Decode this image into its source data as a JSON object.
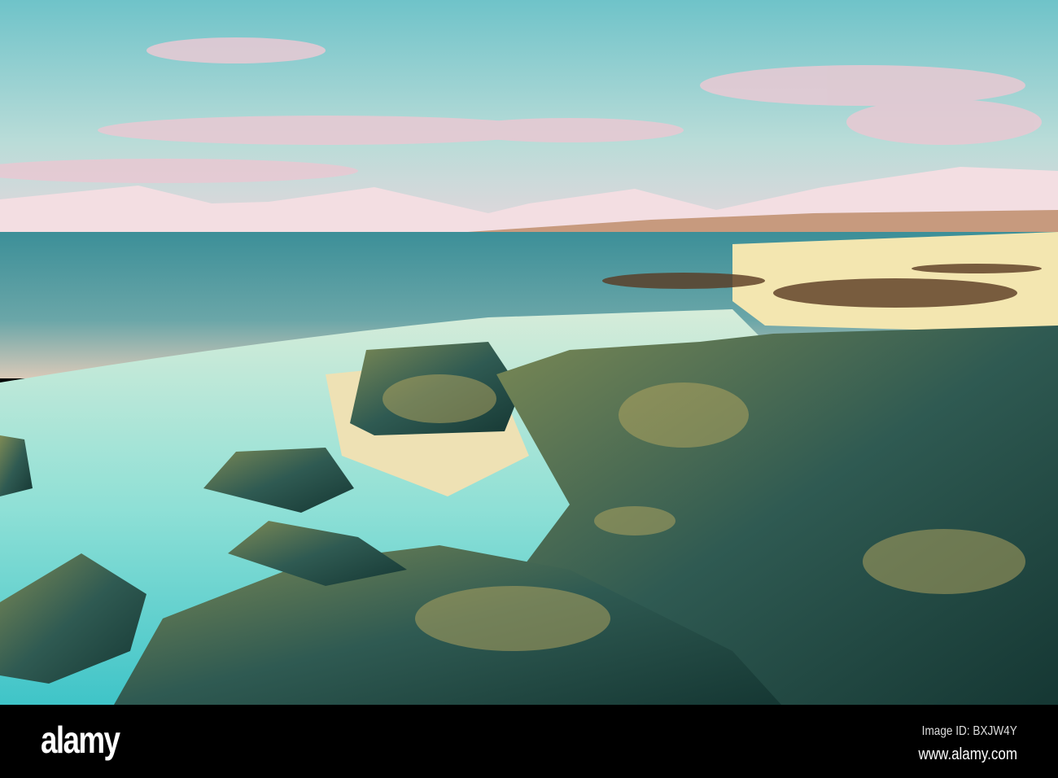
{
  "footer": {
    "logo": "alamy",
    "image_id": "Image ID: BXJW4Y",
    "url": "www.alamy.com"
  },
  "watermark": "alamy"
}
